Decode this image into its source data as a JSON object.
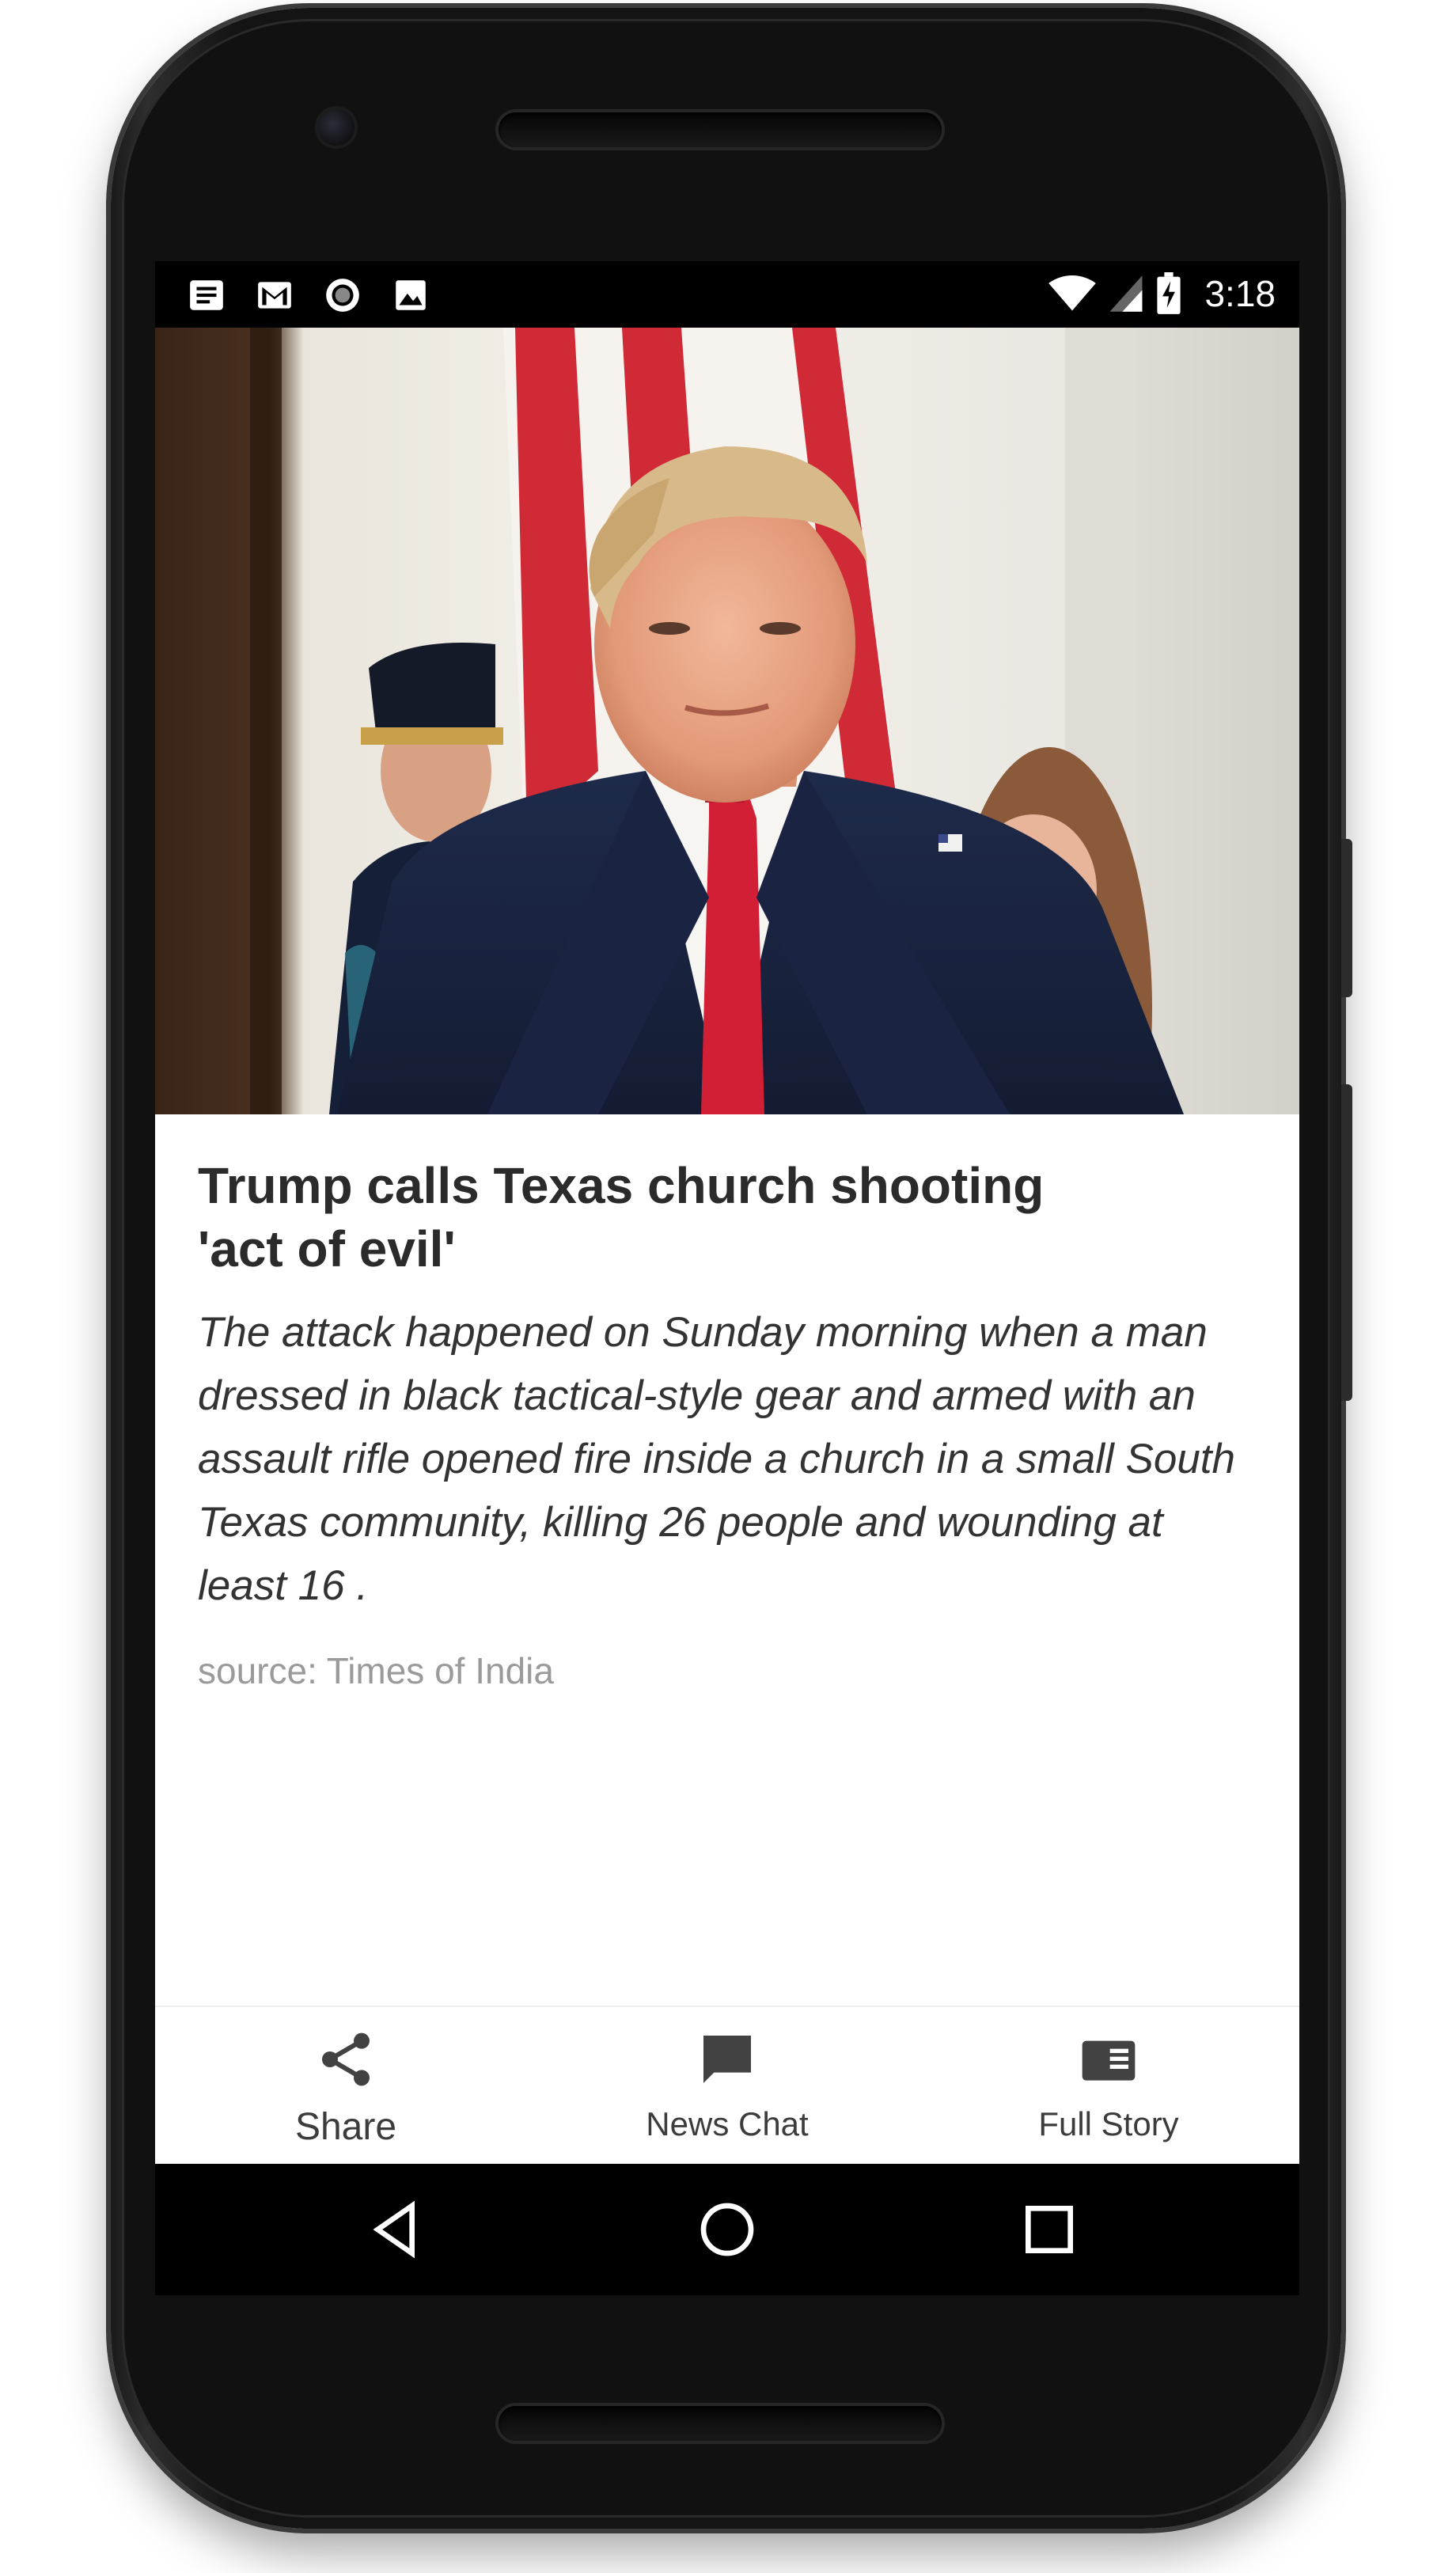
{
  "status_bar": {
    "time": "3:18",
    "left_icons": [
      "notes-icon",
      "gmail-icon",
      "record-icon",
      "image-icon"
    ],
    "right_icons": [
      "wifi-icon",
      "signal-icon",
      "battery-charging-icon"
    ]
  },
  "article": {
    "image_icon": "hero-photo",
    "headline": "Trump calls Texas church shooting 'act of evil'",
    "summary": "The attack happened on Sunday morning when a man dressed in black tactical-style gear and armed with an assault rifle opened fire inside a church in a small South Texas community, killing 26 people and wounding at least 16 .",
    "source": "source: Times of India"
  },
  "actions": {
    "share_label": "Share",
    "chat_label": "News Chat",
    "full_story_label": "Full Story",
    "icon_color": "#424242"
  },
  "nav": {
    "icons": [
      "back-icon",
      "home-icon",
      "recents-icon"
    ]
  },
  "colors": {
    "status_bar_bg": "#000000",
    "nav_bar_bg": "#000000",
    "headline": "#2b2b2b",
    "source": "#9a9a9a"
  }
}
